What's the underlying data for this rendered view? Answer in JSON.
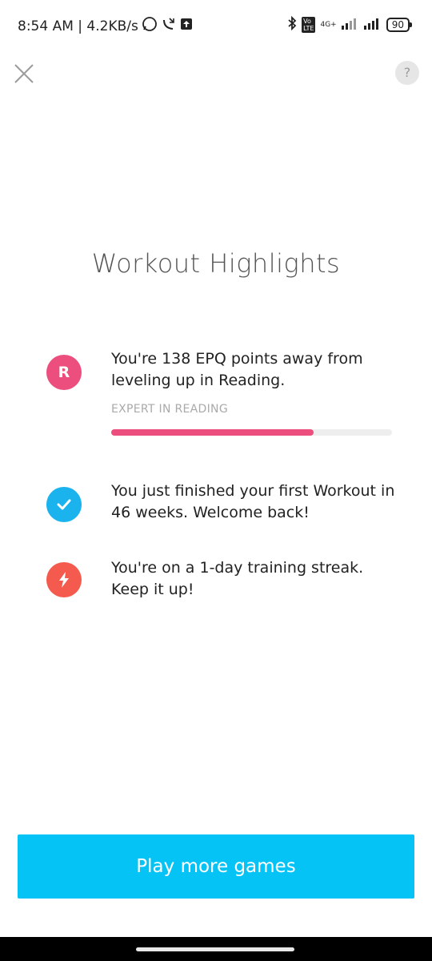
{
  "status_bar": {
    "time_speed": "8:54 AM | 4.2KB/s",
    "network": "4G+",
    "battery": "90"
  },
  "header": {
    "title": "Workout Highlights"
  },
  "highlights": [
    {
      "icon_letter": "R",
      "icon_color": "#ec4f7e",
      "text": "You're 138 EPQ points away from leveling up in Reading.",
      "sub_label": "EXPERT IN READING",
      "progress": 0.72
    },
    {
      "icon": "check-icon",
      "icon_color": "#1ab3ee",
      "text": "You just finished your first Workout in 46 weeks. Welcome back!"
    },
    {
      "icon": "lightning-icon",
      "icon_color": "#f55a4e",
      "text": "You're on a 1-day training streak. Keep it up!"
    }
  ],
  "actions": {
    "play_more": "Play more games",
    "help": "?"
  },
  "colors": {
    "cta": "#05c3f5",
    "progress_track": "#eeeeee"
  }
}
